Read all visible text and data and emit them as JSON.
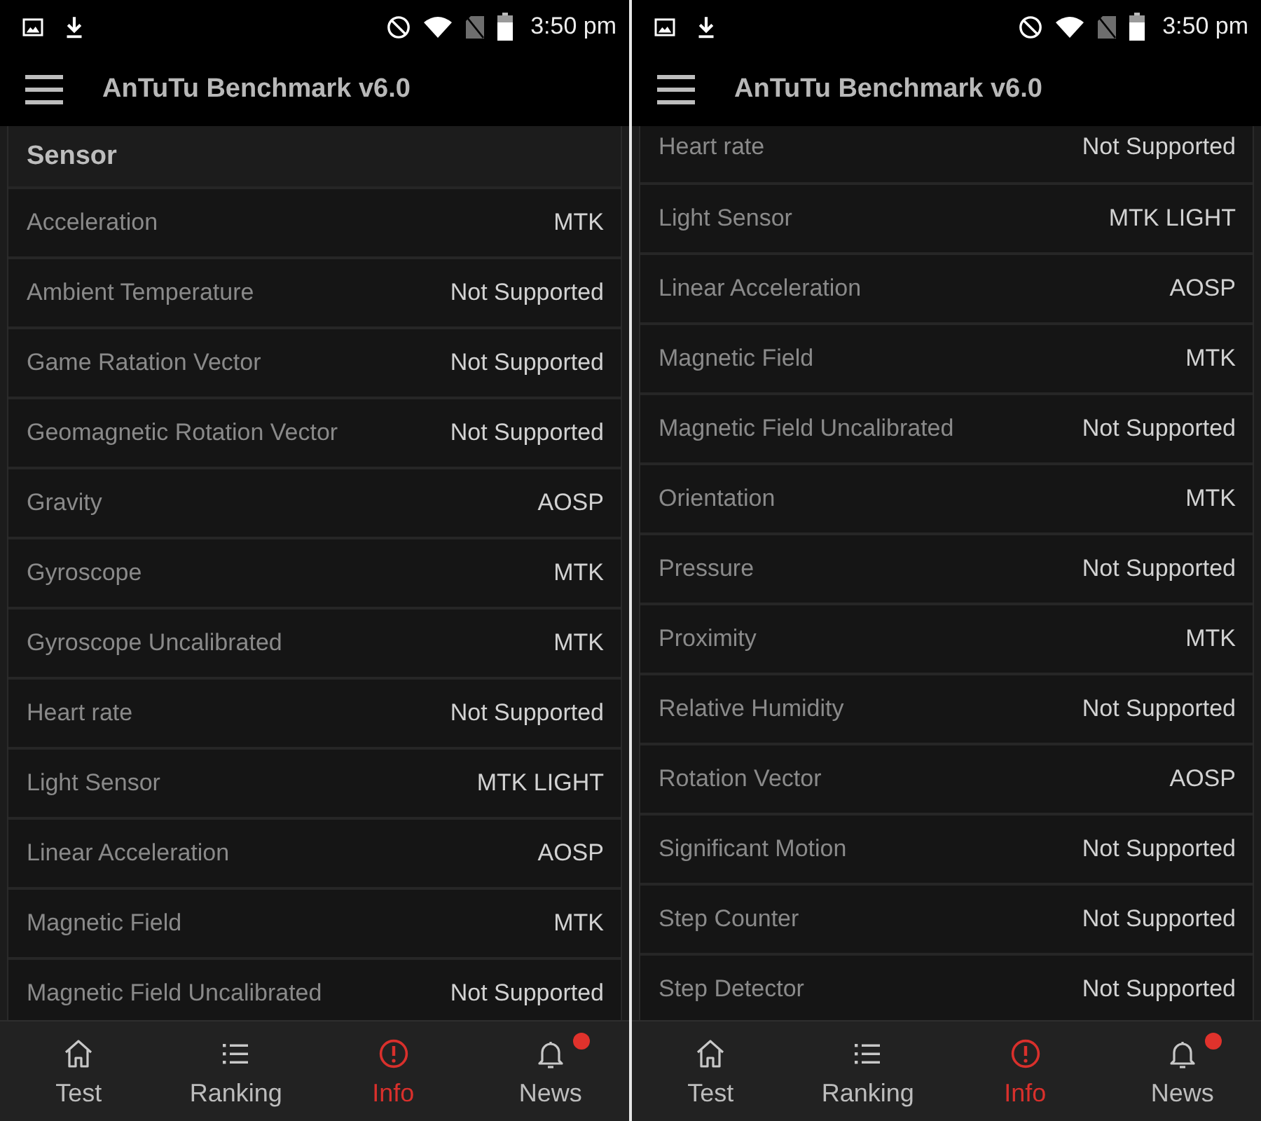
{
  "screens": [
    {
      "status_bar": {
        "time": "3:50 pm"
      },
      "app_bar": {
        "title": "AnTuTu Benchmark v6.0"
      },
      "section_title": "Sensor",
      "rows": [
        {
          "label": "Acceleration",
          "value": "MTK"
        },
        {
          "label": "Ambient Temperature",
          "value": "Not Supported"
        },
        {
          "label": "Game Ratation Vector",
          "value": "Not Supported"
        },
        {
          "label": "Geomagnetic Rotation Vector",
          "value": "Not Supported"
        },
        {
          "label": "Gravity",
          "value": "AOSP"
        },
        {
          "label": "Gyroscope",
          "value": "MTK"
        },
        {
          "label": "Gyroscope Uncalibrated",
          "value": "MTK"
        },
        {
          "label": "Heart rate",
          "value": "Not Supported"
        },
        {
          "label": "Light Sensor",
          "value": "MTK LIGHT"
        },
        {
          "label": "Linear Acceleration",
          "value": "AOSP"
        },
        {
          "label": "Magnetic Field",
          "value": "MTK"
        },
        {
          "label": "Magnetic Field Uncalibrated",
          "value": "Not Supported"
        }
      ],
      "nav": [
        {
          "label": "Test",
          "selected": false,
          "badge": false
        },
        {
          "label": "Ranking",
          "selected": false,
          "badge": false
        },
        {
          "label": "Info",
          "selected": true,
          "badge": false
        },
        {
          "label": "News",
          "selected": false,
          "badge": true
        }
      ]
    },
    {
      "status_bar": {
        "time": "3:50 pm"
      },
      "app_bar": {
        "title": "AnTuTu Benchmark v6.0"
      },
      "rows": [
        {
          "label": "Heart rate",
          "value": "Not Supported"
        },
        {
          "label": "Light Sensor",
          "value": "MTK LIGHT"
        },
        {
          "label": "Linear Acceleration",
          "value": "AOSP"
        },
        {
          "label": "Magnetic Field",
          "value": "MTK"
        },
        {
          "label": "Magnetic Field Uncalibrated",
          "value": "Not Supported"
        },
        {
          "label": "Orientation",
          "value": "MTK"
        },
        {
          "label": "Pressure",
          "value": "Not Supported"
        },
        {
          "label": "Proximity",
          "value": "MTK"
        },
        {
          "label": "Relative Humidity",
          "value": "Not Supported"
        },
        {
          "label": "Rotation Vector",
          "value": "AOSP"
        },
        {
          "label": "Significant Motion",
          "value": "Not Supported"
        },
        {
          "label": "Step Counter",
          "value": "Not Supported"
        },
        {
          "label": "Step Detector",
          "value": "Not Supported"
        }
      ],
      "nav": [
        {
          "label": "Test",
          "selected": false,
          "badge": false
        },
        {
          "label": "Ranking",
          "selected": false,
          "badge": false
        },
        {
          "label": "Info",
          "selected": true,
          "badge": false
        },
        {
          "label": "News",
          "selected": false,
          "badge": true
        }
      ]
    }
  ]
}
